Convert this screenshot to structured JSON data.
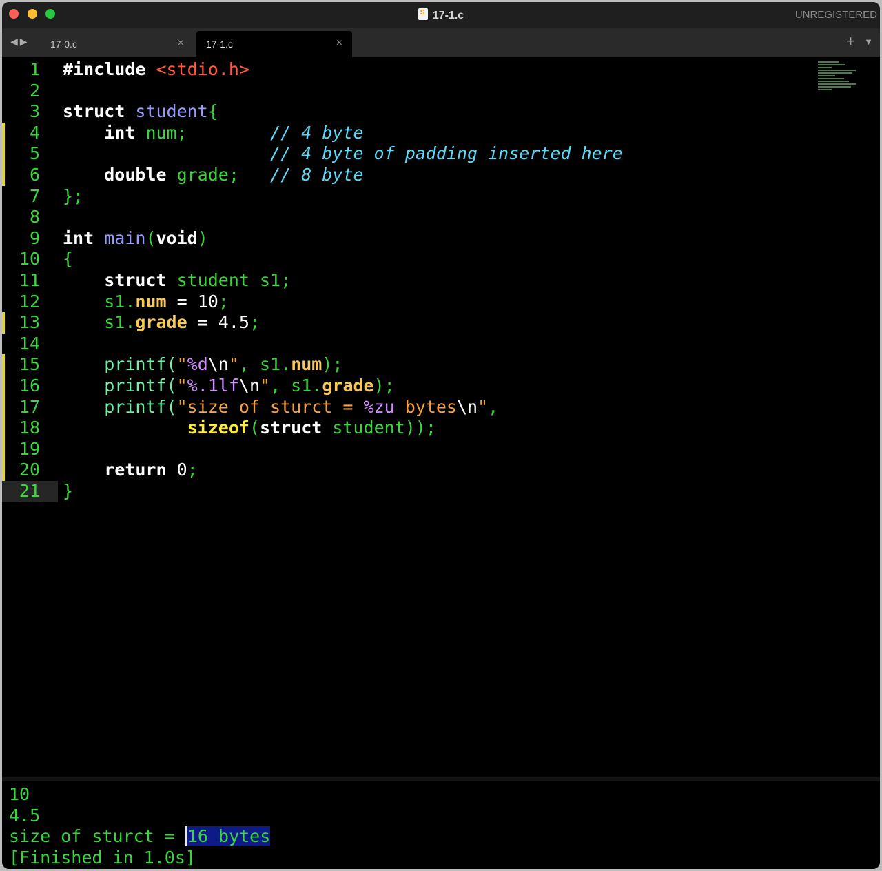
{
  "window": {
    "title": "17-1.c",
    "registration_status": "UNREGISTERED"
  },
  "tabs": [
    {
      "label": "17-0.c",
      "active": false
    },
    {
      "label": "17-1.c",
      "active": true
    }
  ],
  "editor": {
    "line_numbers": [
      "1",
      "2",
      "3",
      "4",
      "5",
      "6",
      "7",
      "8",
      "9",
      "10",
      "11",
      "12",
      "13",
      "14",
      "15",
      "16",
      "17",
      "18",
      "19",
      "20",
      "21"
    ],
    "current_line": 21,
    "modified_lines": [
      4,
      5,
      6,
      13,
      15,
      16,
      17,
      18,
      19,
      20
    ],
    "code_lines": [
      "#include <stdio.h>",
      "",
      "struct student{",
      "    int num;        // 4 byte",
      "                    // 4 byte of padding inserted here",
      "    double grade;   // 8 byte",
      "};",
      "",
      "int main(void)",
      "{",
      "    struct student s1;",
      "    s1.num = 10;",
      "    s1.grade = 4.5;",
      "",
      "    printf(\"%d\\n\", s1.num);",
      "    printf(\"%.1lf\\n\", s1.grade);",
      "    printf(\"size of sturct = %zu bytes\\n\",",
      "            sizeof(struct student));",
      "",
      "    return 0;",
      "}"
    ]
  },
  "output": {
    "lines": [
      "10",
      "4.5",
      "size of sturct = ",
      "[Finished in 1.0s]"
    ],
    "selected_text": "16 bytes"
  },
  "colors": {
    "background": "#000000",
    "line_numbers": "#3dd53d",
    "comment": "#5fd8f8",
    "keyword": "#ffffff",
    "type_name": "#9b9bff",
    "include": "#ff5a3c",
    "string": "#f5a23c",
    "format_spec": "#d28cff",
    "field": "#f7c95b",
    "sizeof": "#ffeb3b",
    "modified_marker": "#e3d72e",
    "selection": "#0e1a86"
  }
}
